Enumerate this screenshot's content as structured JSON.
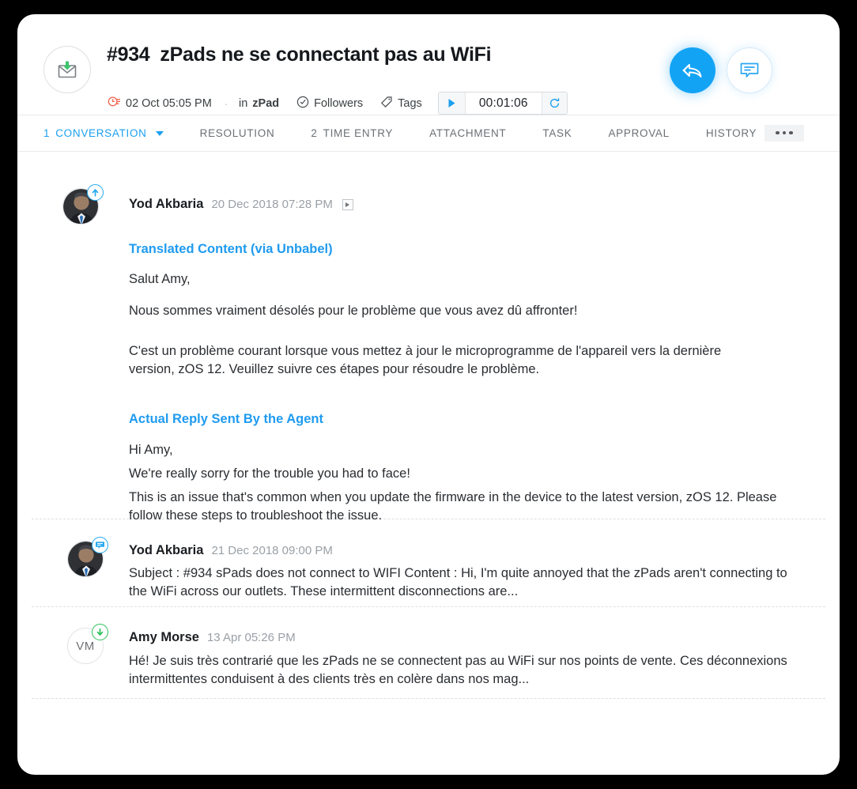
{
  "header": {
    "envelope_icon": "envelope-incoming-icon",
    "ticket_number": "#934",
    "ticket_title": "zPads ne se connectant pas au WiFi",
    "date": "02 Oct 05:05 PM",
    "separator_dot": ".",
    "in_label": "in",
    "in_value": "zPad",
    "followers_label": "Followers",
    "tags_label": "Tags",
    "timer": {
      "play_icon": "play-icon",
      "value": "00:01:06",
      "reset_icon": "refresh-icon"
    },
    "actions": [
      {
        "name": "reply-all-button",
        "icon": "reply-all-icon"
      },
      {
        "name": "add-comment-button",
        "icon": "comment-icon"
      }
    ],
    "accent_color": "#13a3f5",
    "incoming_color": "#2ec05a",
    "clock_icon_color": "#f4614b"
  },
  "tabs": [
    {
      "count": "1",
      "label": "CONVERSATION",
      "active": true,
      "has_caret": true
    },
    {
      "count": "",
      "label": "RESOLUTION",
      "active": false,
      "has_caret": false
    },
    {
      "count": "2",
      "label": "TIME ENTRY",
      "active": false,
      "has_caret": false
    },
    {
      "count": "",
      "label": "ATTACHMENT",
      "active": false,
      "has_caret": false
    },
    {
      "count": "",
      "label": "TASK",
      "active": false,
      "has_caret": false
    },
    {
      "count": "",
      "label": "APPROVAL",
      "active": false,
      "has_caret": false
    },
    {
      "count": "",
      "label": "HISTORY",
      "active": false,
      "has_caret": false
    }
  ],
  "tab_overflow_icon": "more-horizontal-icon",
  "messages": [
    {
      "author": "Yod Akbaria",
      "time": "20 Dec 2018 07:28 PM",
      "avatar_type": "photo",
      "badge": "outgoing-reply-icon",
      "badge_kind": "out",
      "has_expander": true,
      "sections": [
        {
          "heading": "Translated Content (via Unbabel)",
          "lines": [
            "Salut Amy,",
            "Nous sommes vraiment désolés pour le problème que vous avez dû affronter!"
          ],
          "paragraph": "C'est un problème courant lorsque vous mettez à jour le microprogramme de l'appareil vers la dernière version, zOS 12. Veuillez suivre ces étapes pour résoudre le problème."
        },
        {
          "heading": "Actual Reply Sent By the Agent",
          "lines": [
            "Hi Amy,",
            "We're really sorry for the trouble you had to face!"
          ],
          "paragraph": "This is an issue that's common when you update the firmware in the device to the latest version, zOS 12. Please follow these steps to troubleshoot the issue."
        }
      ]
    },
    {
      "author": "Yod Akbaria",
      "time": "21 Dec 2018 09:00 PM",
      "avatar_type": "photo",
      "badge": "comment-note-icon",
      "badge_kind": "note",
      "has_expander": false,
      "preview": "Subject : #934 sPads does not connect to WIFI Content : Hi, I'm quite annoyed that the zPads aren't connecting to the WiFi across our outlets. These intermittent disconnections are..."
    },
    {
      "author": "Amy Morse",
      "time": "13 Apr 05:26 PM",
      "avatar_type": "initials",
      "avatar_initials": "VM",
      "badge": "incoming-mail-icon",
      "badge_kind": "in",
      "has_expander": false,
      "preview": "Hé! Je suis très contrarié que les zPads ne se connectent pas au WiFi sur nos points de vente. Ces déconnexions intermittentes conduisent à des clients très en colère dans nos mag..."
    }
  ]
}
